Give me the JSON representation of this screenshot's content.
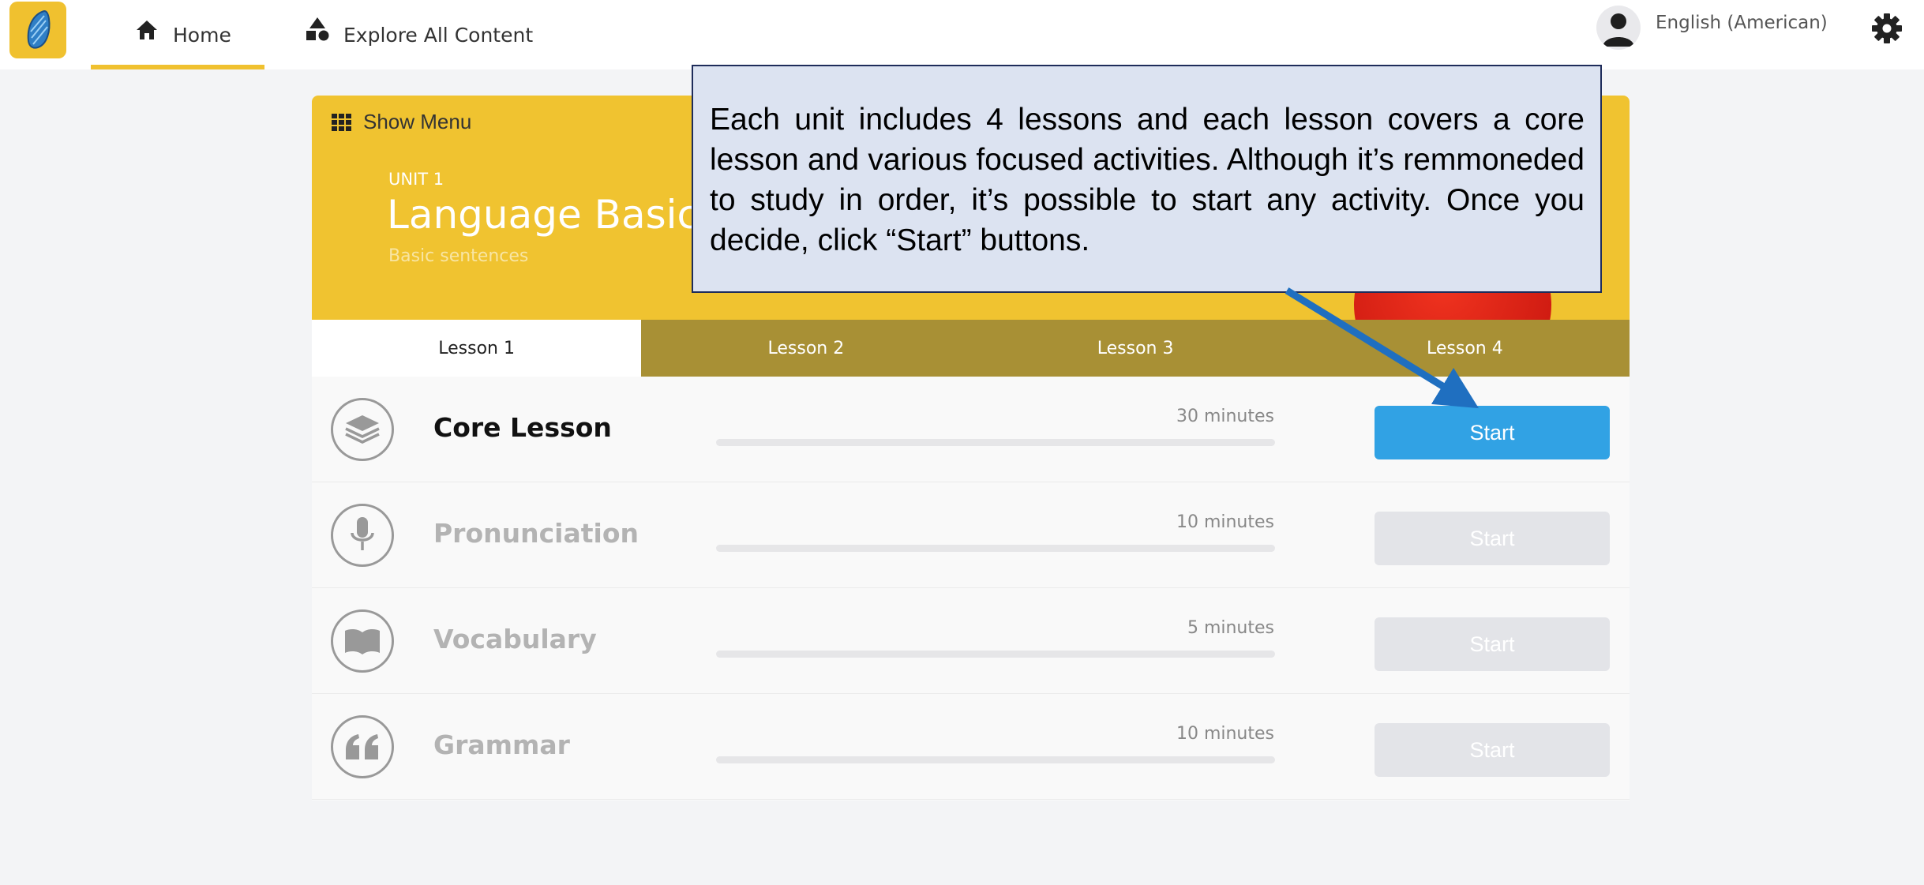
{
  "nav": {
    "home": "Home",
    "explore": "Explore All Content",
    "language": "English (American)"
  },
  "unit": {
    "menu_label": "Show Menu",
    "label": "UNIT 1",
    "title": "Language Basics",
    "subtitle": "Basic sentences"
  },
  "tabs": [
    "Lesson 1",
    "Lesson 2",
    "Lesson 3",
    "Lesson 4"
  ],
  "active_tab": "Lesson 1",
  "activities": [
    {
      "name": "Core Lesson",
      "time": "30 minutes",
      "button": "Start",
      "icon": "layers-icon",
      "enabled": true
    },
    {
      "name": "Pronunciation",
      "time": "10 minutes",
      "button": "Start",
      "icon": "microphone-icon",
      "enabled": false
    },
    {
      "name": "Vocabulary",
      "time": "5 minutes",
      "button": "Start",
      "icon": "book-icon",
      "enabled": false
    },
    {
      "name": "Grammar",
      "time": "10 minutes",
      "button": "Start",
      "icon": "quote-icon",
      "enabled": false
    }
  ],
  "callout": {
    "text": "Each unit includes 4 lessons and each lesson covers a core lesson and various focused activities. Although it’s remmoneded to study in order, it’s possible to start any activity. Once you decide, click “Start” buttons."
  },
  "colors": {
    "brand_yellow": "#f0c330",
    "tab_bar": "#a89035",
    "start_active": "#31a2e4",
    "start_disabled": "#e3e4e8",
    "callout_bg": "#dce3f1",
    "arrow": "#1f6fc0"
  }
}
